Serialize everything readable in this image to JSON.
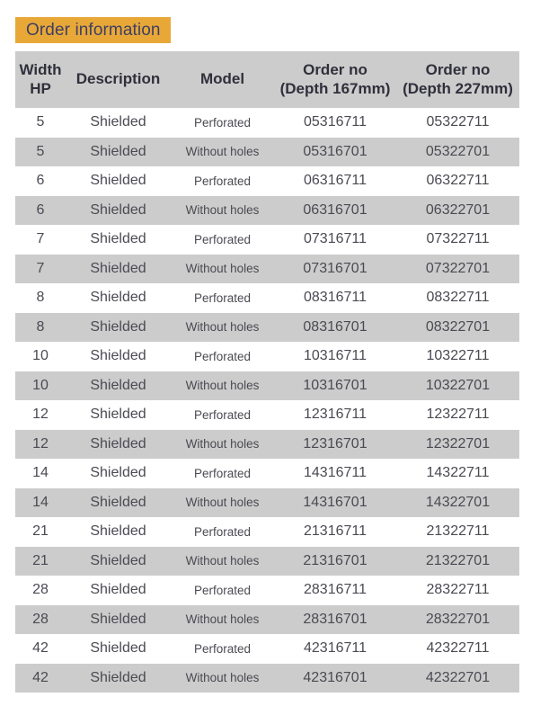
{
  "banner": {
    "title": "Order information",
    "background_color": "#e8a838",
    "text_color": "#3f3f63"
  },
  "table": {
    "header_background_color": "#cccccc",
    "row_alt_background_color": "#cccccc",
    "row_background_color": "#ffffff",
    "text_color": "#4a4a52",
    "columns": [
      {
        "line1": "Width",
        "line2": "HP"
      },
      {
        "line1": "Description",
        "line2": ""
      },
      {
        "line1": "Model",
        "line2": ""
      },
      {
        "line1": "Order no",
        "line2": "(Depth 167mm)"
      },
      {
        "line1": "Order no",
        "line2": "(Depth 227mm)"
      }
    ],
    "rows": [
      {
        "width_hp": "5",
        "description": "Shielded",
        "model": "Perforated",
        "order_no_167": "05316711",
        "order_no_227": "05322711"
      },
      {
        "width_hp": "5",
        "description": "Shielded",
        "model": "Without holes",
        "order_no_167": "05316701",
        "order_no_227": "05322701"
      },
      {
        "width_hp": "6",
        "description": "Shielded",
        "model": "Perforated",
        "order_no_167": "06316711",
        "order_no_227": "06322711"
      },
      {
        "width_hp": "6",
        "description": "Shielded",
        "model": "Without holes",
        "order_no_167": "06316701",
        "order_no_227": "06322701"
      },
      {
        "width_hp": "7",
        "description": "Shielded",
        "model": "Perforated",
        "order_no_167": "07316711",
        "order_no_227": "07322711"
      },
      {
        "width_hp": "7",
        "description": "Shielded",
        "model": "Without holes",
        "order_no_167": "07316701",
        "order_no_227": "07322701"
      },
      {
        "width_hp": "8",
        "description": "Shielded",
        "model": "Perforated",
        "order_no_167": "08316711",
        "order_no_227": "08322711"
      },
      {
        "width_hp": "8",
        "description": "Shielded",
        "model": "Without holes",
        "order_no_167": "08316701",
        "order_no_227": "08322701"
      },
      {
        "width_hp": "10",
        "description": "Shielded",
        "model": "Perforated",
        "order_no_167": "10316711",
        "order_no_227": "10322711"
      },
      {
        "width_hp": "10",
        "description": "Shielded",
        "model": "Without holes",
        "order_no_167": "10316701",
        "order_no_227": "10322701"
      },
      {
        "width_hp": "12",
        "description": "Shielded",
        "model": "Perforated",
        "order_no_167": "12316711",
        "order_no_227": "12322711"
      },
      {
        "width_hp": "12",
        "description": "Shielded",
        "model": "Without holes",
        "order_no_167": "12316701",
        "order_no_227": "12322701"
      },
      {
        "width_hp": "14",
        "description": "Shielded",
        "model": "Perforated",
        "order_no_167": "14316711",
        "order_no_227": "14322711"
      },
      {
        "width_hp": "14",
        "description": "Shielded",
        "model": "Without holes",
        "order_no_167": "14316701",
        "order_no_227": "14322701"
      },
      {
        "width_hp": "21",
        "description": "Shielded",
        "model": "Perforated",
        "order_no_167": "21316711",
        "order_no_227": "21322711"
      },
      {
        "width_hp": "21",
        "description": "Shielded",
        "model": "Without holes",
        "order_no_167": "21316701",
        "order_no_227": "21322701"
      },
      {
        "width_hp": "28",
        "description": "Shielded",
        "model": "Perforated",
        "order_no_167": "28316711",
        "order_no_227": "28322711"
      },
      {
        "width_hp": "28",
        "description": "Shielded",
        "model": "Without holes",
        "order_no_167": "28316701",
        "order_no_227": "28322701"
      },
      {
        "width_hp": "42",
        "description": "Shielded",
        "model": "Perforated",
        "order_no_167": "42316711",
        "order_no_227": "42322711"
      },
      {
        "width_hp": "42",
        "description": "Shielded",
        "model": "Without holes",
        "order_no_167": "42316701",
        "order_no_227": "42322701"
      }
    ]
  }
}
